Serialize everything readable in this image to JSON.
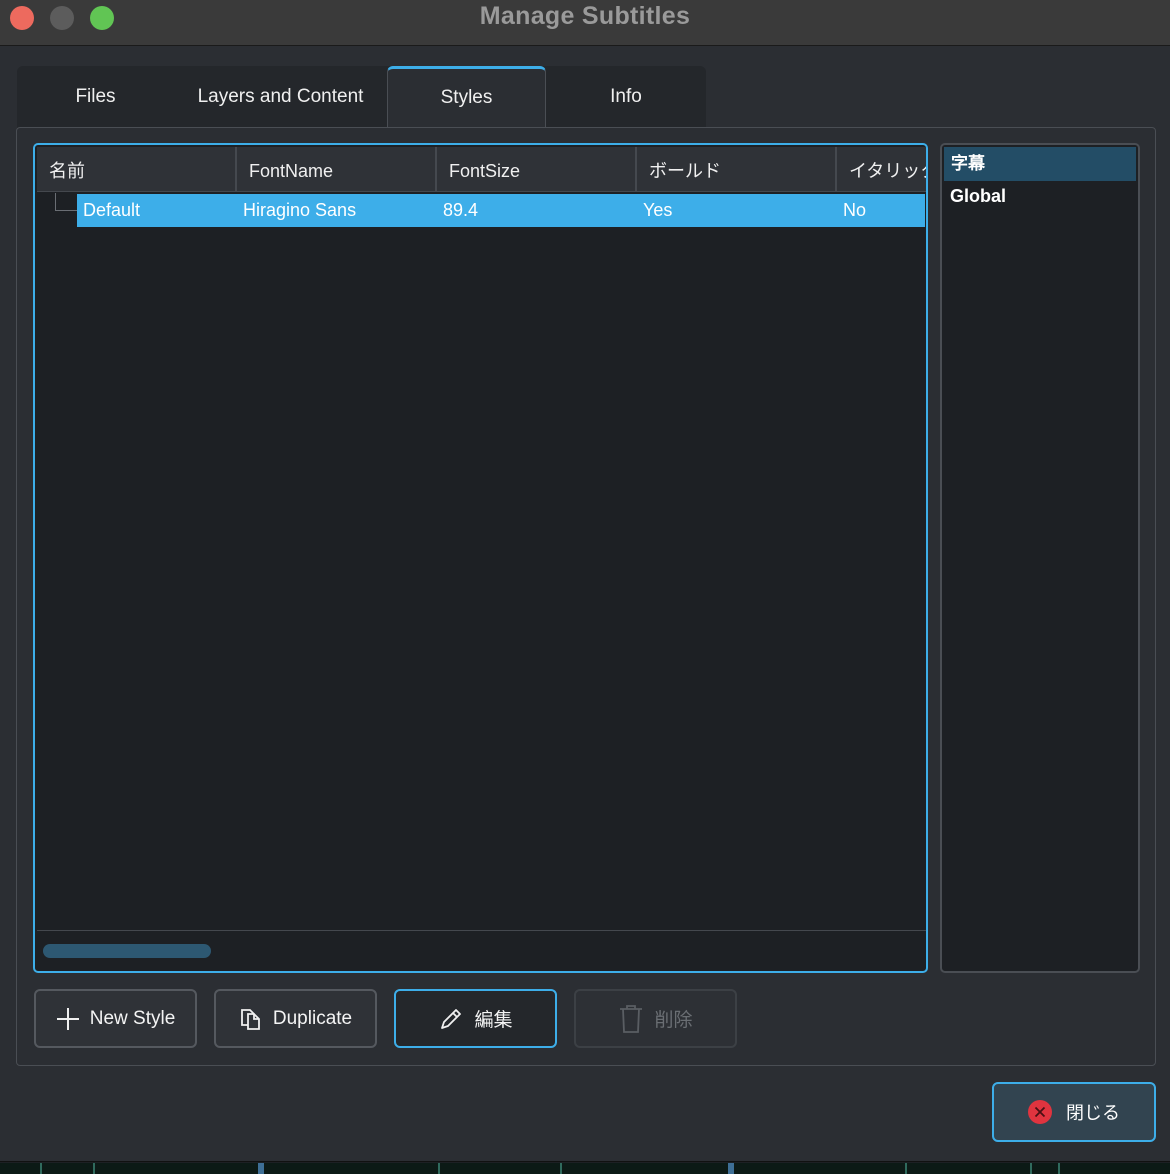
{
  "window": {
    "title": "Manage Subtitles"
  },
  "tabs": [
    {
      "label": "Files"
    },
    {
      "label": "Layers and Content"
    },
    {
      "label": "Styles"
    },
    {
      "label": "Info"
    }
  ],
  "active_tab": "Styles",
  "styles_table": {
    "columns": [
      "名前",
      "FontName",
      "FontSize",
      "ボールド",
      "イタリック"
    ],
    "rows": [
      {
        "name": "Default",
        "font_name": "Hiragino Sans",
        "font_size": "89.4",
        "bold": "Yes",
        "italic": "No",
        "selected": true
      }
    ]
  },
  "scope_list": {
    "header": "字幕",
    "items": [
      "Global"
    ]
  },
  "buttons": {
    "new_style": "New Style",
    "duplicate": "Duplicate",
    "edit": "編集",
    "delete": "削除",
    "close": "閉じる"
  },
  "colors": {
    "accent": "#3daee9",
    "window_bg": "#2b2e33",
    "table_bg": "#1d2024",
    "close_icon": "#e0343f"
  },
  "icons": {
    "new_style": "plus-icon",
    "duplicate": "copy-icon",
    "edit": "pencil-icon",
    "delete": "trash-icon",
    "close": "close-circle-icon"
  }
}
